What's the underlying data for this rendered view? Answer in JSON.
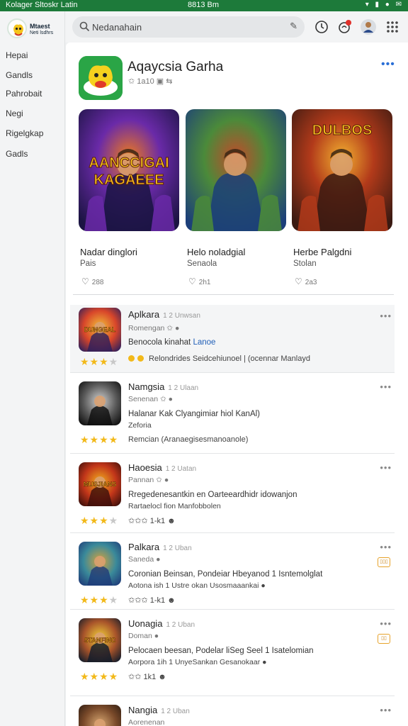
{
  "status": {
    "left": "Kolager Sltoskr Latin",
    "time": "8813 Bm",
    "icons": "▾ ▮ ● ✉"
  },
  "logo": {
    "line1": "Mtaest",
    "line2": "Neti lsdhrs"
  },
  "sidebar": {
    "items": [
      {
        "label": "Hepai"
      },
      {
        "label": "Gandls"
      },
      {
        "label": "Pahrobait"
      },
      {
        "label": "Negi"
      },
      {
        "label": "Rigelgkap"
      },
      {
        "label": "Gadls"
      }
    ]
  },
  "search": {
    "placeholder": "Nedanahain"
  },
  "app": {
    "title": "Aqaycsia Garha",
    "meta": "✩ 1a10  ▣  ⇆",
    "more": "•••"
  },
  "featured": [
    {
      "art": "AANCCIGAI KAGAEEE",
      "title": "Nadar dinglori",
      "sub": "Pais",
      "likes": "288",
      "palette": [
        "#1b1442",
        "#6a2aa8",
        "#f07b1a"
      ]
    },
    {
      "art": "",
      "title": "Helo noladgial",
      "sub": "Senaola",
      "likes": "2h1",
      "palette": [
        "#1c3f7a",
        "#4b8a3a",
        "#c24a2a"
      ]
    },
    {
      "art": "DULBOS",
      "title": "Herbe Palgdni",
      "sub": "Stolan",
      "likes": "2a3",
      "palette": [
        "#3a1a12",
        "#b23a1a",
        "#f2b030"
      ]
    }
  ],
  "list": [
    {
      "name": "Aplkara",
      "tag": "1 2 Unwsan",
      "cat": "Romengan  ✩  ●",
      "desc": "Benocola kinahat",
      "desc_link": "Lanoe",
      "desc2": "",
      "stars": "★★★",
      "dim_stars": "★",
      "extra": "Relondrides Seidcehiunoel | (ocennar Manlayd",
      "menu": "•••",
      "badge": "",
      "palette": [
        "#2a1e5c",
        "#d8462a",
        "#f2c23a"
      ],
      "art": "DUNGEAL"
    },
    {
      "name": "Namgsia",
      "tag": "1 2 Ulaan",
      "cat": "Senenan  ✩  ●",
      "desc": "Halanar Kak  Clyangimiar hiol KanAl)",
      "desc_link": "",
      "desc2": "Zeforia",
      "stars": "★★★★",
      "dim_stars": "",
      "extra": "Remcian  (Aranaegisesmanoanole)",
      "menu": "•••",
      "badge": "",
      "palette": [
        "#0b0b0b",
        "#5a5a5a",
        "#d0d0d0"
      ],
      "art": ""
    },
    {
      "name": "Haoesia",
      "tag": "1 2 Uatan",
      "cat": "Pannan  ✩  ●",
      "desc": "Rregedenesantkin en  Oarteeardhidr idowanjon",
      "desc_link": "",
      "desc2": "Rartaelocl fion  Manfobbolen",
      "stars": "★★★",
      "dim_stars": "★",
      "extra": "✩✩✩ 1-k1  ☻",
      "menu": "•••",
      "badge": "",
      "palette": [
        "#3a0e0a",
        "#c2361a",
        "#f2b01e"
      ],
      "art": "MUSJIANS"
    },
    {
      "name": "Palkara",
      "tag": "1 2 Uban",
      "cat": "Saneda  ●",
      "desc": "Coronian Beinsan, Pondeiar Hbeyanod 1 Isntemolglat",
      "desc_link": "",
      "desc2": "Aotona ish 1 Ustre okan Usosmaaankai  ●",
      "stars": "★★★",
      "dim_stars": "★",
      "extra": "✩✩✩ 1-k1  ☻",
      "menu": "•••",
      "badge": "▯▯▯",
      "palette": [
        "#1e3a78",
        "#3a8a9a",
        "#d8a23a"
      ],
      "art": ""
    },
    {
      "name": "Uonagia",
      "tag": "1 2 Uban",
      "cat": "Doman  ●",
      "desc": "Pelocaen beesan, Podelar liSeg Seel 1 Isatelomian",
      "desc_link": "",
      "desc2": "Aorpora 1ih 1 UnyeSankan Gesanokaar  ●",
      "stars": "★★★★",
      "dim_stars": "",
      "extra": "✩✩ 1k1  ☻",
      "menu": "•••",
      "badge": "▯▯",
      "palette": [
        "#0e1a2a",
        "#a8542a",
        "#f2d23a"
      ],
      "art": "STANFINC"
    },
    {
      "name": "Nangia",
      "tag": "1 2 Uban",
      "cat": "Aorenenan",
      "desc": "",
      "desc_link": "",
      "desc2": "",
      "stars": "",
      "dim_stars": "",
      "extra": "",
      "menu": "•••",
      "badge": "",
      "palette": [
        "#2a1a10",
        "#7a4a2a",
        "#d8a872"
      ],
      "art": ""
    }
  ]
}
